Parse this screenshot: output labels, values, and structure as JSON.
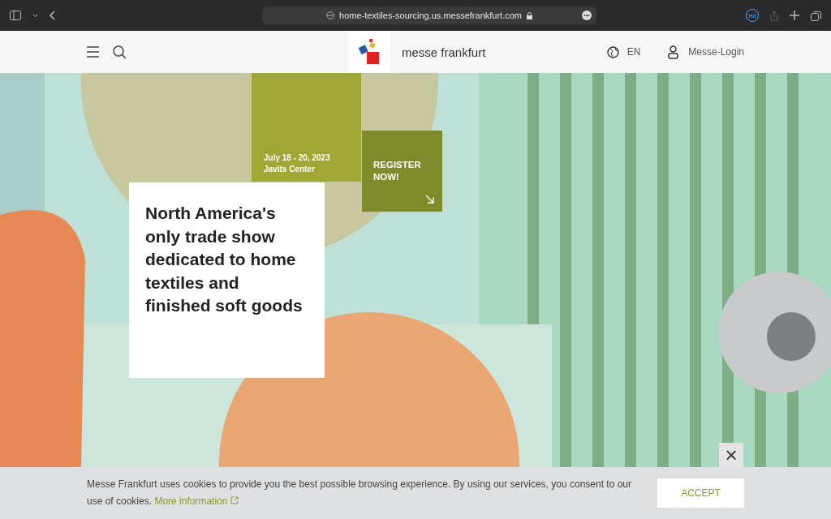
{
  "browser": {
    "url": "home-textiles-sourcing.us.messefrankfurt.com",
    "profile_badge": "Hd"
  },
  "header": {
    "brand": "messe frankfurt",
    "language": "EN",
    "login": "Messe-Login"
  },
  "hero": {
    "kind": "picture",
    "date": "July 18 - 20, 2023",
    "venue": "Javits Center",
    "register": "REGISTER NOW!",
    "headline": "North America's only trade show dedicated to home textiles and finished soft goods"
  },
  "cookie_banner": {
    "text": "Messe Frankfurt uses cookies to provide you the best possible browsing experience. By using our services, you consent to our use of cookies.",
    "link": "More information",
    "accept": "ACCEPT",
    "close": "×"
  }
}
